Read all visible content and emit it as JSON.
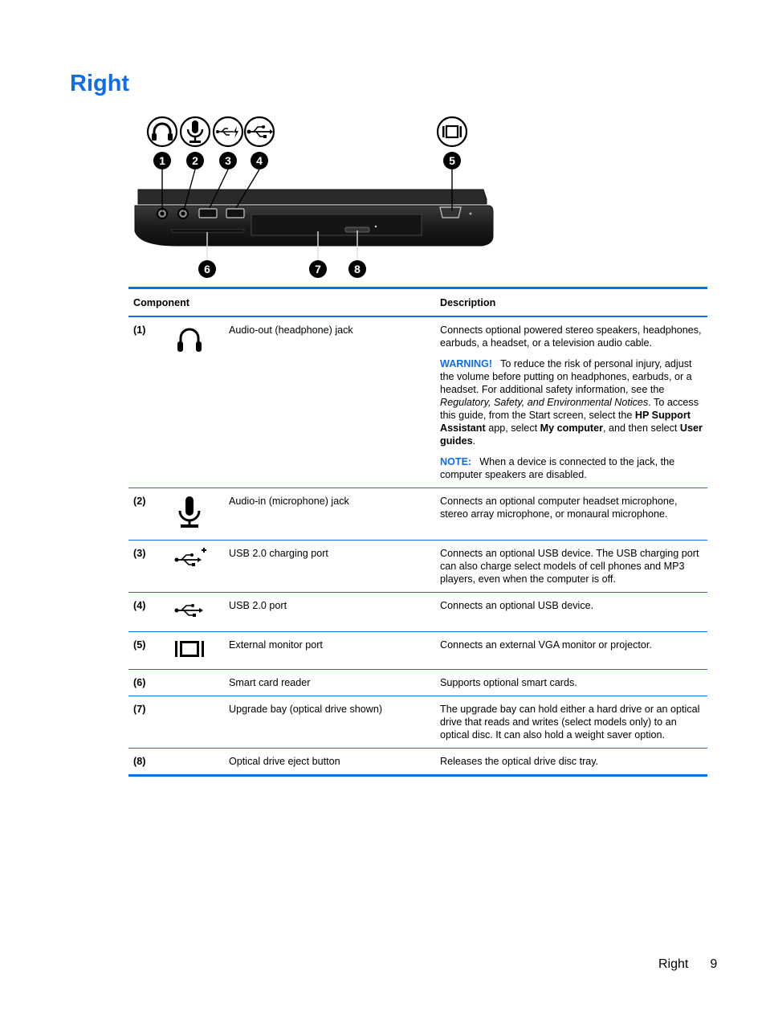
{
  "page": {
    "title": "Right",
    "footer_section": "Right",
    "footer_page": "9"
  },
  "figure": {
    "top_icons": [
      {
        "number": "1",
        "icon": "headphone-icon"
      },
      {
        "number": "2",
        "icon": "microphone-icon"
      },
      {
        "number": "3",
        "icon": "usb-charging-icon"
      },
      {
        "number": "4",
        "icon": "usb-icon"
      },
      {
        "number": "5",
        "icon": "external-monitor-icon"
      }
    ],
    "bottom_callouts": [
      "6",
      "7",
      "8"
    ]
  },
  "table": {
    "headers": {
      "component": "Component",
      "description": "Description"
    },
    "rows": [
      {
        "num": "(1)",
        "icon": "headphone-icon",
        "name": "Audio-out (headphone) jack",
        "desc": "Connects optional powered stereo speakers, headphones, earbuds, a headset, or a television audio cable.",
        "warning_label": "WARNING!",
        "warning_parts": [
          {
            "t": "To reduce the risk of personal injury, adjust the volume before putting on headphones, earbuds, or a headset. For additional safety information, see the ",
            "s": "n"
          },
          {
            "t": "Regulatory, Safety, and Environmental Notices",
            "s": "i"
          },
          {
            "t": ". To access this guide, from the Start screen, select the ",
            "s": "n"
          },
          {
            "t": "HP Support Assistant",
            "s": "b"
          },
          {
            "t": " app, select ",
            "s": "n"
          },
          {
            "t": "My computer",
            "s": "b"
          },
          {
            "t": ", and then select ",
            "s": "n"
          },
          {
            "t": "User guides",
            "s": "b"
          },
          {
            "t": ".",
            "s": "n"
          }
        ],
        "note_label": "NOTE:",
        "note_text": "When a device is connected to the jack, the computer speakers are disabled."
      },
      {
        "num": "(2)",
        "icon": "microphone-icon",
        "name": "Audio-in (microphone) jack",
        "desc": "Connects an optional computer headset microphone, stereo array microphone, or monaural microphone."
      },
      {
        "num": "(3)",
        "icon": "usb-charging-icon",
        "name": "USB 2.0 charging port",
        "desc": "Connects an optional USB device. The USB charging port can also charge select models of cell phones and MP3 players, even when the computer is off."
      },
      {
        "num": "(4)",
        "icon": "usb-icon",
        "name": "USB 2.0 port",
        "desc": "Connects an optional USB device."
      },
      {
        "num": "(5)",
        "icon": "external-monitor-icon",
        "name": "External monitor port",
        "desc": "Connects an external VGA monitor or projector."
      },
      {
        "num": "(6)",
        "icon": "",
        "name": "Smart card reader",
        "desc": "Supports optional smart cards."
      },
      {
        "num": "(7)",
        "icon": "",
        "name": "Upgrade bay (optical drive shown)",
        "desc": "The upgrade bay can hold either a hard drive or an optical drive that reads and writes (select models only) to an optical disc. It can also hold a weight saver option."
      },
      {
        "num": "(8)",
        "icon": "",
        "name": "Optical drive eject button",
        "desc": "Releases the optical drive disc tray."
      }
    ]
  },
  "colors": {
    "accent": "#0f6ee6"
  }
}
